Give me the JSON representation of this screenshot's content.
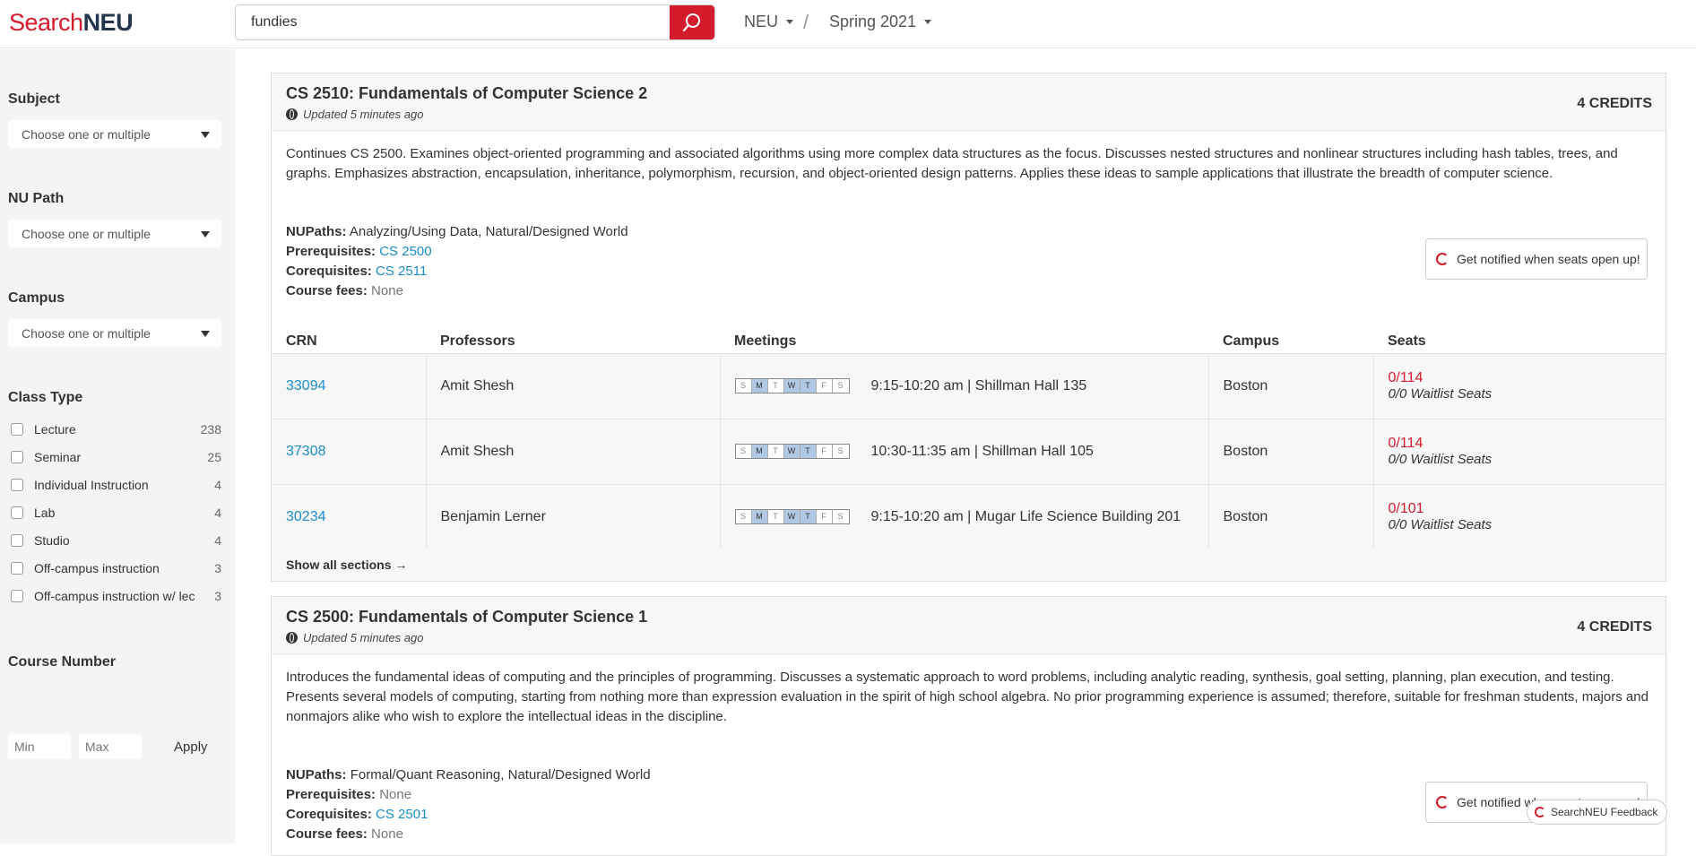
{
  "header": {
    "logo_search": "Search",
    "logo_neu": "NEU",
    "search_value": "fundies",
    "college": "NEU",
    "separator": "/",
    "term": "Spring 2021"
  },
  "sidebar": {
    "subject": {
      "heading": "Subject",
      "placeholder": "Choose one or multiple"
    },
    "nupath": {
      "heading": "NU Path",
      "placeholder": "Choose one or multiple"
    },
    "campus": {
      "heading": "Campus",
      "placeholder": "Choose one or multiple"
    },
    "class_type": {
      "heading": "Class Type",
      "items": [
        {
          "label": "Lecture",
          "count": "238"
        },
        {
          "label": "Seminar",
          "count": "25"
        },
        {
          "label": "Individual Instruction",
          "count": "4"
        },
        {
          "label": "Lab",
          "count": "4"
        },
        {
          "label": "Studio",
          "count": "4"
        },
        {
          "label": "Off-campus instruction",
          "count": "3"
        },
        {
          "label": "Off-campus instruction w/ lec",
          "count": "3"
        }
      ]
    },
    "course_number": {
      "heading": "Course Number",
      "min_placeholder": "Min",
      "max_placeholder": "Max",
      "apply": "Apply"
    }
  },
  "courses": [
    {
      "title": "CS 2510: Fundamentals of Computer Science 2",
      "updated": "Updated 5 minutes ago",
      "credits": "4 CREDITS",
      "description": "Continues CS 2500. Examines object-oriented programming and associated algorithms using more complex data structures as the focus. Discusses nested structures and nonlinear structures including hash tables, trees, and graphs. Emphasizes abstraction, encapsulation, inheritance, polymorphism, recursion, and object-oriented design patterns. Applies these ideas to sample applications that illustrate the breadth of computer science.",
      "nupaths_label": "NUPaths:",
      "nupaths": "Analyzing/Using Data, Natural/Designed World",
      "prereq_label": "Prerequisites:",
      "prereq": "CS 2500",
      "coreq_label": "Corequisites:",
      "coreq": "CS 2511",
      "fees_label": "Course fees:",
      "fees": "None",
      "notify": "Get notified when seats open up!",
      "table_headers": {
        "crn": "CRN",
        "professors": "Professors",
        "meetings": "Meetings",
        "campus": "Campus",
        "seats": "Seats"
      },
      "sections": [
        {
          "crn": "33094",
          "professor": "Amit Shesh",
          "meeting": "9:15-10:20 am | Shillman Hall 135",
          "campus": "Boston",
          "seats": "0/114",
          "waitlist": "0/0 Waitlist Seats"
        },
        {
          "crn": "37308",
          "professor": "Amit Shesh",
          "meeting": "10:30-11:35 am | Shillman Hall 105",
          "campus": "Boston",
          "seats": "0/114",
          "waitlist": "0/0 Waitlist Seats"
        },
        {
          "crn": "30234",
          "professor": "Benjamin Lerner",
          "meeting": "9:15-10:20 am | Mugar Life Science Building 201",
          "campus": "Boston",
          "seats": "0/101",
          "waitlist": "0/0 Waitlist Seats"
        }
      ],
      "show_all": "Show all sections →"
    },
    {
      "title": "CS 2500: Fundamentals of Computer Science 1",
      "updated": "Updated 5 minutes ago",
      "credits": "4 CREDITS",
      "description": "Introduces the fundamental ideas of computing and the principles of programming. Discusses a systematic approach to word problems, including analytic reading, synthesis, goal setting, planning, plan execution, and testing. Presents several models of computing, starting from nothing more than expression evaluation in the spirit of high school algebra. No prior programming experience is assumed; therefore, suitable for freshman students, majors and nonmajors alike who wish to explore the intellectual ideas in the discipline.",
      "nupaths_label": "NUPaths:",
      "nupaths": "Formal/Quant Reasoning, Natural/Designed World",
      "prereq_label": "Prerequisites:",
      "prereq": "None",
      "coreq_label": "Corequisites:",
      "coreq": "CS 2501",
      "fees_label": "Course fees:",
      "fees": "None",
      "notify": "Get notified when seats open up!"
    }
  ],
  "day_letters": [
    "S",
    "M",
    "T",
    "W",
    "T",
    "F",
    "S"
  ],
  "active_days": [
    false,
    true,
    false,
    true,
    true,
    false,
    false
  ],
  "feedback": "SearchNEU Feedback",
  "colors": {
    "brand_red": "#d41b2c",
    "link_blue": "#1a8dc9",
    "day_active": "#b0c8e3"
  }
}
